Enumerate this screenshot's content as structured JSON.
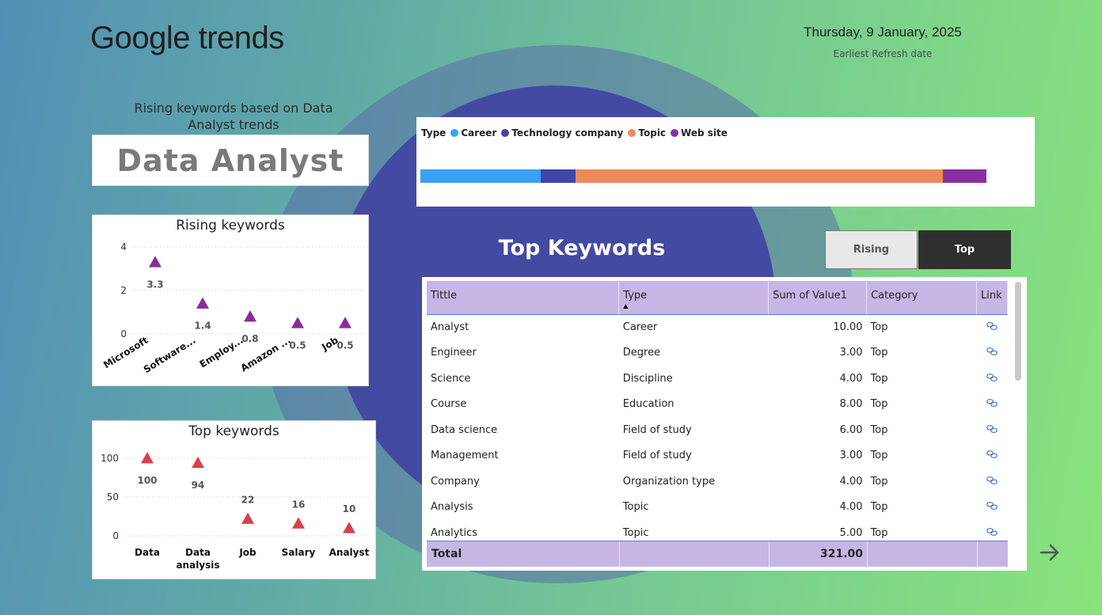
{
  "header": {
    "brand_bold": "Google",
    "brand_light": "trends",
    "date": "Thursday, 9 January, 2025",
    "date_caption": "Earliest Refresh date"
  },
  "left": {
    "subtitle": "Rising keywords based on Data Analyst trends",
    "keyword": "Data Analyst"
  },
  "colors": {
    "rising_marker": "#8a2d96",
    "top_marker": "#d8404b",
    "career": "#3aa0f5",
    "technology_company": "#3e46a8",
    "topic": "#ec8a5c",
    "web_site": "#8b2fa0",
    "header_row": "#c6b6e6"
  },
  "chart_data": [
    {
      "type": "scatter",
      "title": "Rising keywords",
      "categories": [
        "Microsoft",
        "Software...",
        "Employ...",
        "Amazon ...",
        "Job"
      ],
      "values": [
        3.3,
        1.4,
        0.8,
        0.5,
        0.5
      ],
      "value_labels": [
        "3.3",
        "1.4",
        "0.8",
        "0.5",
        "0.5"
      ],
      "yticks": [
        "4",
        "2",
        "0"
      ],
      "ylim": [
        0,
        4
      ],
      "marker": "triangle"
    },
    {
      "type": "scatter",
      "title": "Top keywords",
      "categories": [
        "Data",
        "Data analysis",
        "Job",
        "Salary",
        "Analyst"
      ],
      "category_lines": [
        [
          "Data"
        ],
        [
          "Data",
          "analysis"
        ],
        [
          "Job"
        ],
        [
          "Salary"
        ],
        [
          "Analyst"
        ]
      ],
      "values": [
        100,
        94,
        22,
        16,
        10
      ],
      "value_labels": [
        "100",
        "94",
        "22",
        "16",
        "10"
      ],
      "yticks": [
        "100",
        "50",
        "0"
      ],
      "ylim": [
        0,
        100
      ],
      "marker": "triangle"
    },
    {
      "type": "bar",
      "stacked": true,
      "legend_title": "Type",
      "series": [
        {
          "name": "Career",
          "value": 10,
          "color": "#3aa0f5"
        },
        {
          "name": "Technology company",
          "value": 2.9,
          "color": "#3e46a8"
        },
        {
          "name": "Topic",
          "value": 30.5,
          "color": "#ec8a5c"
        },
        {
          "name": "Web site",
          "value": 3.6,
          "color": "#8b2fa0"
        }
      ]
    }
  ],
  "top_keywords": {
    "title": "Top Keywords",
    "toggle": {
      "rising": "Rising",
      "top": "Top",
      "active": "Top"
    },
    "columns": [
      "Tittle",
      "Type",
      "Sum of Value1",
      "Category",
      "Link"
    ],
    "rows": [
      [
        "Analyst",
        "Career",
        "10.00",
        "Top"
      ],
      [
        "Engineer",
        "Degree",
        "3.00",
        "Top"
      ],
      [
        "Science",
        "Discipline",
        "4.00",
        "Top"
      ],
      [
        "Course",
        "Education",
        "8.00",
        "Top"
      ],
      [
        "Data science",
        "Field of study",
        "6.00",
        "Top"
      ],
      [
        "Management",
        "Field of study",
        "3.00",
        "Top"
      ],
      [
        "Company",
        "Organization type",
        "4.00",
        "Top"
      ],
      [
        "Analysis",
        "Topic",
        "4.00",
        "Top"
      ],
      [
        "Analytics",
        "Topic",
        "5.00",
        "Top"
      ]
    ],
    "total_label": "Total",
    "total_value": "321.00"
  },
  "nav": {
    "next_icon": "arrow-right-icon"
  }
}
